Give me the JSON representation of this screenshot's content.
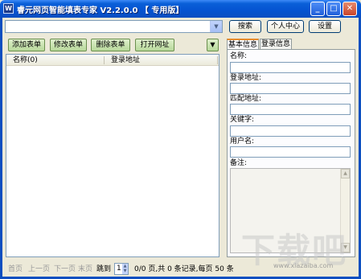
{
  "window": {
    "title": "睿元网页智能填表专家 V2.2.0.0 【 专用版】",
    "app_icon_text": "W"
  },
  "top_buttons": {
    "search": "搜索",
    "personal_center": "个人中心",
    "settings": "设置"
  },
  "form_buttons": {
    "add": "添加表单",
    "edit": "修改表单",
    "delete": "删除表单",
    "open_url": "打开网址",
    "dropdown": "▼"
  },
  "table": {
    "columns": [
      "名称(0)",
      "登录地址"
    ]
  },
  "tabs": {
    "basic_info": "基本信息",
    "login_info": "登录信息"
  },
  "fields": {
    "name": "名称:",
    "login_address": "登录地址:",
    "match_address": "匹配地址:",
    "keyword": "关键字:",
    "username": "用户名:",
    "remark": "备注:"
  },
  "pager": {
    "first": "首页",
    "prev": "上一页",
    "next": "下一页",
    "last": "末页",
    "jump": "跳到",
    "jump_value": "1",
    "status": "0/0 页,共 0 条记录,每页 50 条"
  },
  "watermark": {
    "text": "下载吧",
    "sub": "www.xiazaiba.com"
  }
}
